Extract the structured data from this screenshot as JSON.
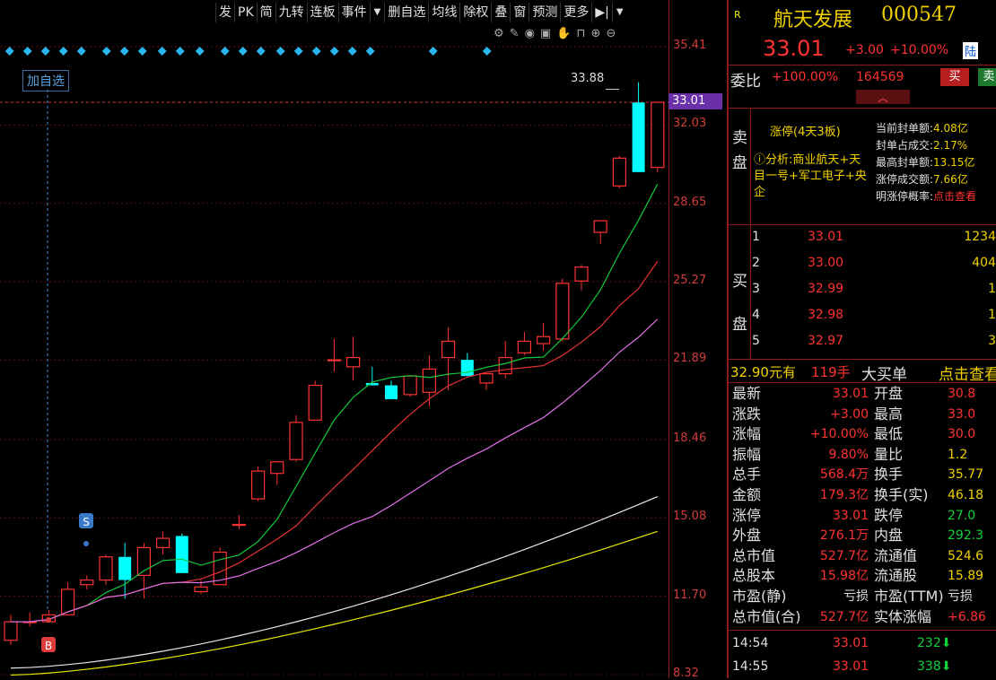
{
  "toolbar": {
    "items": [
      "发",
      "PK",
      "简",
      "九转",
      "连板",
      "事件",
      "▼",
      "删自选",
      "均线",
      "除权",
      "叠",
      "窗",
      "预测",
      "更多",
      "▶|",
      "▼"
    ]
  },
  "chart": {
    "add_watch": "加自选",
    "high_label": "33.88",
    "current_price": "33.01",
    "axis_labels": [
      "35.41",
      "33.01",
      "32.03",
      "28.65",
      "25.27",
      "21.89",
      "18.46",
      "15.08",
      "11.70",
      "8.32"
    ],
    "signal_s": "S",
    "signal_b": "B",
    "icons": [
      "settings-icon",
      "pen-icon",
      "eye-icon",
      "briefcase-icon",
      "hand-icon",
      "lock-icon",
      "zoom-in-icon",
      "zoom-out-icon"
    ]
  },
  "chart_data": {
    "type": "candlestick",
    "x": [
      1,
      2,
      3,
      4,
      5,
      6,
      7,
      8,
      9,
      10,
      11,
      12,
      13,
      14,
      15,
      16,
      17,
      18,
      19,
      20,
      21,
      22,
      23,
      24,
      25,
      26,
      27,
      28,
      29,
      30,
      31,
      32,
      33,
      34
    ],
    "ohlc": [
      [
        9.8,
        10.9,
        9.6,
        10.6
      ],
      [
        10.6,
        11.0,
        10.4,
        10.6
      ],
      [
        10.6,
        11.1,
        10.6,
        10.9
      ],
      [
        10.9,
        12.3,
        10.9,
        12.0
      ],
      [
        12.2,
        12.6,
        12.0,
        12.4
      ],
      [
        12.4,
        13.5,
        12.2,
        13.4
      ],
      [
        13.4,
        14.0,
        11.6,
        12.4
      ],
      [
        12.6,
        14.0,
        11.6,
        13.8
      ],
      [
        13.8,
        14.5,
        13.5,
        14.2
      ],
      [
        14.3,
        14.4,
        12.7,
        12.7
      ],
      [
        11.9,
        12.4,
        11.8,
        12.1
      ],
      [
        12.2,
        13.8,
        12.2,
        13.6
      ],
      [
        14.8,
        15.2,
        14.6,
        14.8
      ],
      [
        15.9,
        17.3,
        15.8,
        17.1
      ],
      [
        17.0,
        17.5,
        16.5,
        17.5
      ],
      [
        17.6,
        19.5,
        17.5,
        19.2
      ],
      [
        19.3,
        21.0,
        19.3,
        20.8
      ],
      [
        21.9,
        22.8,
        21.4,
        21.9
      ],
      [
        21.6,
        22.9,
        21.0,
        22.0
      ],
      [
        20.9,
        21.6,
        20.8,
        20.8
      ],
      [
        20.8,
        21.0,
        20.3,
        20.2
      ],
      [
        20.4,
        21.2,
        20.3,
        21.2
      ],
      [
        20.5,
        22.1,
        19.9,
        21.5
      ],
      [
        22.0,
        23.3,
        20.6,
        22.7
      ],
      [
        21.9,
        22.2,
        21.2,
        21.2
      ],
      [
        20.9,
        21.3,
        20.6,
        21.3
      ],
      [
        21.3,
        22.7,
        21.1,
        22.0
      ],
      [
        22.2,
        23.1,
        22.1,
        22.7
      ],
      [
        22.6,
        23.5,
        22.3,
        22.9
      ],
      [
        22.8,
        25.4,
        22.7,
        25.2
      ],
      [
        25.3,
        26.0,
        24.9,
        25.9
      ],
      [
        27.4,
        27.9,
        26.9,
        27.9
      ],
      [
        29.4,
        30.7,
        29.3,
        30.6
      ],
      [
        33.0,
        33.88,
        30.0,
        30.0
      ],
      [
        30.2,
        33.01,
        30.0,
        33.01
      ]
    ],
    "ylim": [
      8.32,
      35.41
    ]
  },
  "panel": {
    "r_icon": "R",
    "name": "航天发展",
    "code": "000547",
    "price": "33.01",
    "change": "+3.00",
    "pct": "+10.00%",
    "market": "陆",
    "weibi_label": "委比",
    "weibi_value": "+100.00%",
    "weibi_count": "164569",
    "buy_btn": "买",
    "sell_btn": "卖",
    "limit_tag": "涨停(4天3板)",
    "analysis": "分析:商业航天+天目一号+军工电子+央企",
    "seal_rows": [
      {
        "label": "当前封单额:",
        "value": "4.08亿"
      },
      {
        "label": "封单占成交:",
        "value": "2.17%"
      },
      {
        "label": "最高封单额:",
        "value": "13.15亿"
      },
      {
        "label": "涨停成交额:",
        "value": "7.66亿"
      },
      {
        "label": "明涨停概率:",
        "value": "点击查看"
      }
    ],
    "sell_side_label": [
      "卖",
      "盘"
    ],
    "buy_side_label": [
      "买",
      "盘"
    ],
    "bids": [
      {
        "n": "1",
        "price": "33.01",
        "vol": "1234"
      },
      {
        "n": "2",
        "price": "33.00",
        "vol": "404"
      },
      {
        "n": "3",
        "price": "32.99",
        "vol": "1"
      },
      {
        "n": "4",
        "price": "32.98",
        "vol": "1"
      },
      {
        "n": "5",
        "price": "32.97",
        "vol": "3"
      }
    ],
    "big_order": {
      "price": "32.90元有",
      "qty": "119手",
      "label": "大买单",
      "link": "点击查看"
    },
    "stats": [
      {
        "l1": "最新",
        "v1": "33.01",
        "l2": "开盘",
        "v2": "30.8"
      },
      {
        "l1": "涨跌",
        "v1": "+3.00",
        "l2": "最高",
        "v2": "33.0"
      },
      {
        "l1": "涨幅",
        "v1": "+10.00%",
        "l2": "最低",
        "v2": "30.0"
      },
      {
        "l1": "振幅",
        "v1": "9.80%",
        "l2": "量比",
        "v2": "1.2"
      },
      {
        "l1": "总手",
        "v1": "568.4万",
        "l2": "换手",
        "v2": "35.77"
      },
      {
        "l1": "金额",
        "v1": "179.3亿",
        "l2": "换手(实)",
        "v2": "46.18"
      },
      {
        "l1": "涨停",
        "v1": "33.01",
        "l2": "跌停",
        "v2": "27.0"
      },
      {
        "l1": "外盘",
        "v1": "276.1万",
        "l2": "内盘",
        "v2": "292.3"
      },
      {
        "l1": "总市值",
        "v1": "527.7亿",
        "l2": "流通值",
        "v2": "524.6"
      },
      {
        "l1": "总股本",
        "v1": "15.98亿",
        "l2": "流通股",
        "v2": "15.89"
      },
      {
        "l1": "市盈(静)",
        "v1": "亏损",
        "l2": "市盈(TTM)",
        "v2": "亏损"
      },
      {
        "l1": "总市值(合)",
        "v1": "527.7亿",
        "l2": "实体涨幅",
        "v2": "+6.86"
      }
    ],
    "ticks": [
      {
        "time": "14:54",
        "price": "33.01",
        "vol": "232"
      },
      {
        "time": "14:55",
        "price": "33.01",
        "vol": "338"
      }
    ]
  },
  "colors": {
    "up": "#ff3232",
    "down": "#00ffff",
    "ma5": "#12c83c",
    "ma10": "#e63232",
    "ma20": "#e070e8",
    "ma60": "#e8e8e8",
    "ma120": "#e8e800"
  }
}
